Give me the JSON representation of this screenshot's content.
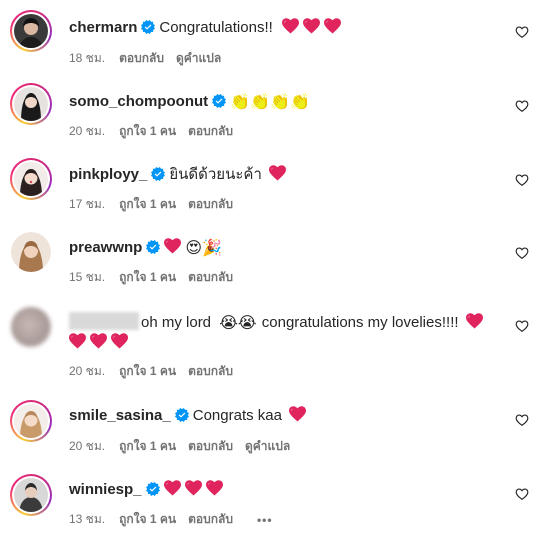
{
  "colors": {
    "heart": "#e0245e",
    "verified": "#0095f6",
    "meta": "#737373",
    "text": "#262626"
  },
  "icons": {
    "verified": "verified-badge-icon",
    "like": "heart-outline-icon",
    "heart_emoji": "red-heart-emoji"
  },
  "comments": [
    {
      "username": "chermarn",
      "text": "Congratulations!!",
      "hearts": 3,
      "time": "18 ชม.",
      "reply": "ตอบกลับ",
      "translate": "ดูคำแปล"
    },
    {
      "username": "somo_chompoonut",
      "emojis": "👏👏👏👏",
      "time": "20 ชม.",
      "likes": "ถูกใจ 1 คน",
      "reply": "ตอบกลับ"
    },
    {
      "username": "pinkployy_",
      "text": "ยินดีด้วยนะค้า",
      "hearts": 1,
      "time": "17 ชม.",
      "likes": "ถูกใจ 1 คน",
      "reply": "ตอบกลับ"
    },
    {
      "username": "preawwnp",
      "emojis": "😍🎉",
      "hearts": 1,
      "time": "15 ชม.",
      "likes": "ถูกใจ 1 คน",
      "reply": "ตอบกลับ"
    },
    {
      "text_a": "oh my lord",
      "emojis_a": "😭😭",
      "text_b": "congratulations my lovelies!!!!",
      "hearts_a": 1,
      "hearts_b": 3,
      "time": "20 ชม.",
      "likes": "ถูกใจ 1 คน",
      "reply": "ตอบกลับ"
    },
    {
      "username": "smile_sasina_",
      "text": "Congrats kaa",
      "hearts": 1,
      "time": "20 ชม.",
      "likes": "ถูกใจ 1 คน",
      "reply": "ตอบกลับ",
      "translate": "ดูคำแปล"
    },
    {
      "username": "winniesp_",
      "hearts": 3,
      "time": "13 ชม.",
      "likes": "ถูกใจ 1 คน",
      "reply": "ตอบกลับ",
      "more": "•••"
    }
  ]
}
